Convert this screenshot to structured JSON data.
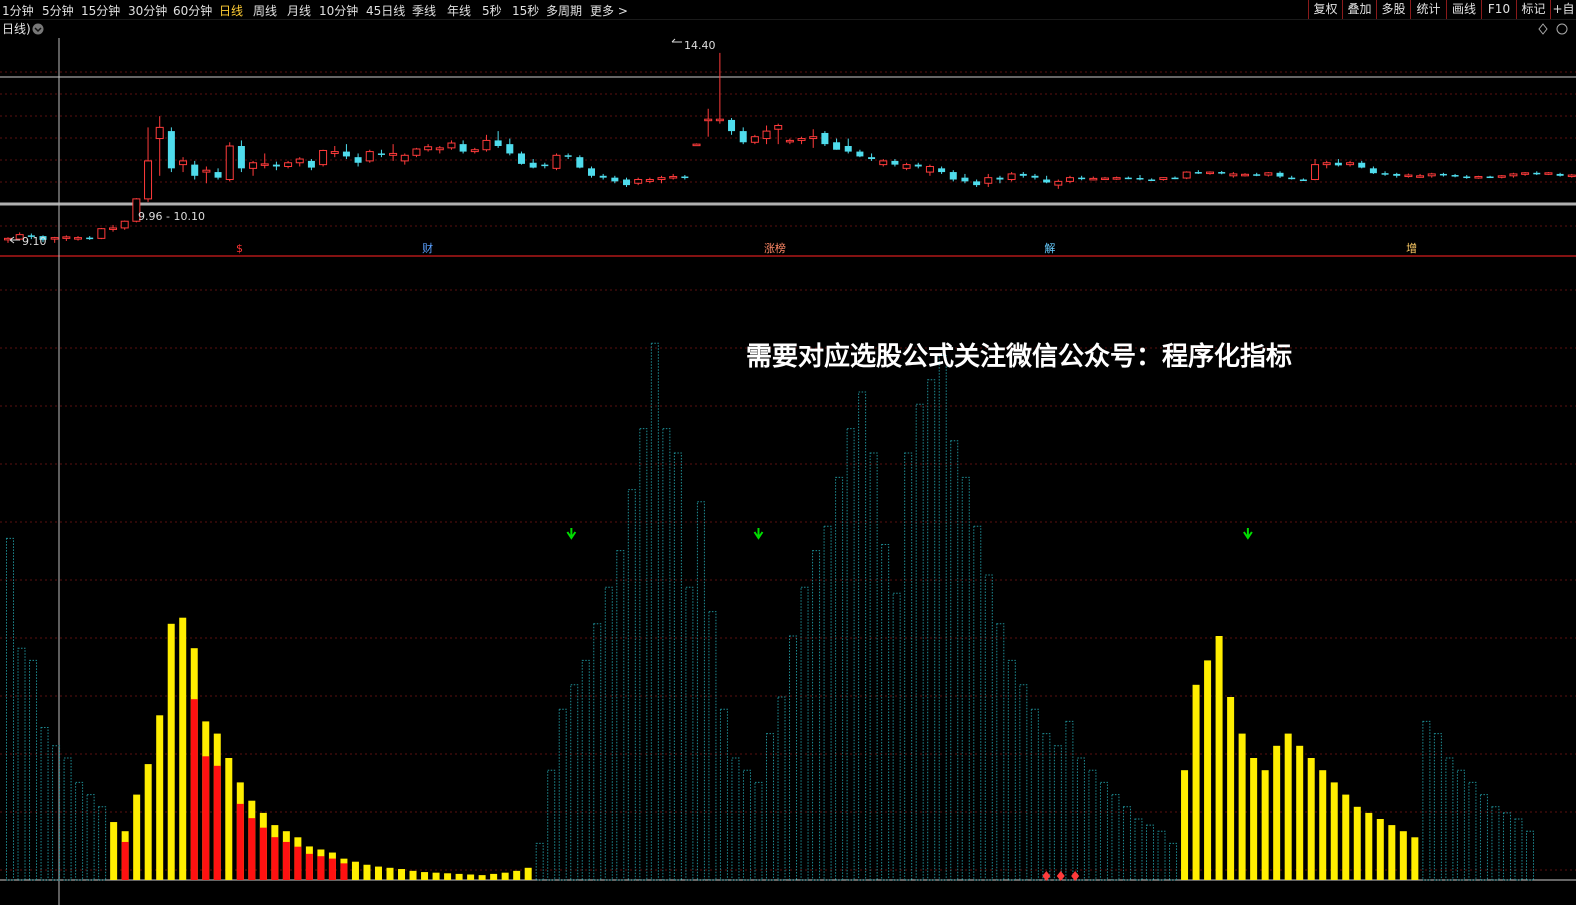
{
  "toolbar": {
    "periods": [
      "1分钟",
      "5分钟",
      "15分钟",
      "30分钟",
      "60分钟",
      "日线",
      "周线",
      "月线",
      "10分钟",
      "45日线",
      "季线",
      "年线",
      "5秒",
      "15秒",
      "多周期",
      "更多 >"
    ],
    "active_period": "日线",
    "tools": [
      "复权",
      "叠加",
      "多股",
      "统计",
      "画线",
      "F10",
      "标记",
      "+自"
    ]
  },
  "panel": {
    "label": "日线)"
  },
  "colors": {
    "up": "#ff3b3b",
    "down": "#4fdcec",
    "volume_default": "#1e8d95",
    "volume_yellow": "#ffee00",
    "volume_red": "#ff1111",
    "marker_green": "#00dd00",
    "annotation_text": "#ffffff"
  },
  "annotation": "需要对应选股公式关注微信公众号：程序化指标",
  "chart_data": [
    {
      "type": "candlestick",
      "high_label": "14.40",
      "low_label": "9.10",
      "range_label": "9.96 - 10.10",
      "ylim": [
        9.0,
        14.8
      ],
      "events": [
        {
          "index": 16,
          "label": "$"
        },
        {
          "index": 29,
          "label": "财"
        },
        {
          "index": 53,
          "label": "涨榜"
        },
        {
          "index": 72,
          "label": "解"
        },
        {
          "index": 97,
          "label": "增"
        }
      ],
      "candles": [
        [
          9.38,
          9.45,
          9.3,
          9.42
        ],
        [
          9.4,
          9.58,
          9.36,
          9.52
        ],
        [
          9.5,
          9.55,
          9.4,
          9.48
        ],
        [
          9.48,
          9.5,
          9.32,
          9.38
        ],
        [
          9.4,
          9.46,
          9.3,
          9.44
        ],
        [
          9.42,
          9.5,
          9.35,
          9.46
        ],
        [
          9.44,
          9.48,
          9.36,
          9.44
        ],
        [
          9.44,
          9.48,
          9.38,
          9.42
        ],
        [
          9.42,
          9.7,
          9.4,
          9.68
        ],
        [
          9.66,
          9.78,
          9.6,
          9.7
        ],
        [
          9.7,
          9.9,
          9.65,
          9.88
        ],
        [
          9.88,
          10.5,
          9.85,
          10.48
        ],
        [
          10.48,
          12.4,
          10.4,
          11.5
        ],
        [
          12.1,
          12.7,
          11.1,
          12.4
        ],
        [
          12.3,
          12.4,
          11.2,
          11.3
        ],
        [
          11.4,
          11.6,
          11.2,
          11.5
        ],
        [
          11.4,
          11.5,
          11.0,
          11.1
        ],
        [
          11.2,
          11.35,
          10.9,
          11.25
        ],
        [
          11.2,
          11.3,
          11.0,
          11.05
        ],
        [
          11.0,
          12.0,
          10.95,
          11.9
        ],
        [
          11.9,
          12.05,
          11.2,
          11.3
        ],
        [
          11.3,
          11.5,
          11.1,
          11.45
        ],
        [
          11.4,
          11.7,
          11.3,
          11.42
        ],
        [
          11.4,
          11.48,
          11.25,
          11.35
        ],
        [
          11.35,
          11.5,
          11.3,
          11.45
        ],
        [
          11.45,
          11.6,
          11.35,
          11.55
        ],
        [
          11.5,
          11.55,
          11.25,
          11.32
        ],
        [
          11.4,
          11.8,
          11.35,
          11.78
        ],
        [
          11.7,
          11.9,
          11.6,
          11.75
        ],
        [
          11.75,
          11.95,
          11.55,
          11.62
        ],
        [
          11.6,
          11.7,
          11.35,
          11.45
        ],
        [
          11.5,
          11.8,
          11.45,
          11.75
        ],
        [
          11.7,
          11.8,
          11.6,
          11.68
        ],
        [
          11.65,
          11.95,
          11.5,
          11.7
        ],
        [
          11.5,
          11.7,
          11.4,
          11.65
        ],
        [
          11.65,
          11.85,
          11.6,
          11.82
        ],
        [
          11.8,
          11.95,
          11.75,
          11.88
        ],
        [
          11.8,
          11.9,
          11.7,
          11.85
        ],
        [
          11.85,
          12.05,
          11.8,
          11.98
        ],
        [
          11.95,
          12.05,
          11.7,
          11.75
        ],
        [
          11.75,
          11.85,
          11.7,
          11.8
        ],
        [
          11.8,
          12.2,
          11.75,
          12.05
        ],
        [
          12.05,
          12.3,
          11.85,
          11.9
        ],
        [
          11.95,
          12.1,
          11.65,
          11.7
        ],
        [
          11.7,
          11.75,
          11.4,
          11.42
        ],
        [
          11.45,
          11.55,
          11.3,
          11.32
        ],
        [
          11.4,
          11.45,
          11.3,
          11.38
        ],
        [
          11.3,
          11.7,
          11.25,
          11.65
        ],
        [
          11.65,
          11.7,
          11.55,
          11.62
        ],
        [
          11.6,
          11.65,
          11.3,
          11.32
        ],
        [
          11.3,
          11.35,
          11.05,
          11.1
        ],
        [
          11.1,
          11.15,
          11.0,
          11.05
        ],
        [
          11.05,
          11.1,
          10.9,
          10.95
        ],
        [
          11.0,
          11.05,
          10.8,
          10.85
        ],
        [
          10.9,
          11.05,
          10.85,
          11.0
        ],
        [
          10.95,
          11.05,
          10.9,
          11.0
        ],
        [
          11.0,
          11.1,
          10.9,
          11.05
        ],
        [
          11.05,
          11.15,
          11.0,
          11.08
        ],
        [
          11.08,
          11.12,
          11.0,
          11.05
        ]
      ],
      "candles_note": "",
      "candles_2": [
        [
          11.95,
          11.97,
          11.93,
          11.95
        ],
        [
          12.6,
          12.9,
          12.15,
          12.62
        ],
        [
          12.6,
          14.4,
          12.5,
          12.62
        ],
        [
          12.6,
          12.65,
          12.2,
          12.3
        ],
        [
          12.3,
          12.4,
          11.95,
          12.0
        ],
        [
          12.0,
          12.2,
          11.95,
          12.15
        ],
        [
          12.1,
          12.45,
          11.95,
          12.3
        ],
        [
          12.35,
          12.5,
          11.95,
          12.45
        ],
        [
          12.05,
          12.1,
          11.95,
          12.05
        ],
        [
          12.05,
          12.15,
          11.95,
          12.1
        ],
        [
          12.1,
          12.35,
          11.85,
          12.15
        ],
        [
          12.25,
          12.3,
          11.9,
          11.95
        ],
        [
          12.0,
          12.1,
          11.8,
          11.8
        ],
        [
          11.9,
          12.1,
          11.7,
          11.75
        ],
        [
          11.75,
          11.8,
          11.6,
          11.62
        ],
        [
          11.6,
          11.7,
          11.5,
          11.55
        ],
        [
          11.4,
          11.55,
          11.35,
          11.5
        ],
        [
          11.5,
          11.55,
          11.35,
          11.4
        ],
        [
          11.3,
          11.45,
          11.25,
          11.4
        ],
        [
          11.4,
          11.45,
          11.3,
          11.35
        ],
        [
          11.2,
          11.4,
          11.1,
          11.35
        ],
        [
          11.3,
          11.35,
          11.15,
          11.2
        ],
        [
          11.2,
          11.25,
          10.95,
          11.0
        ],
        [
          11.05,
          11.15,
          10.9,
          10.95
        ],
        [
          10.95,
          11.0,
          10.8,
          10.85
        ],
        [
          10.9,
          11.15,
          10.8,
          11.05
        ],
        [
          11.05,
          11.1,
          10.9,
          11.0
        ],
        [
          11.0,
          11.2,
          10.95,
          11.15
        ],
        [
          11.15,
          11.2,
          11.05,
          11.1
        ],
        [
          11.1,
          11.15,
          11.0,
          11.05
        ],
        [
          11.0,
          11.1,
          10.9,
          10.92
        ],
        [
          10.85,
          11.0,
          10.75,
          10.95
        ],
        [
          10.95,
          11.1,
          10.9,
          11.05
        ],
        [
          11.05,
          11.1,
          10.98,
          11.02
        ],
        [
          11.03,
          11.08,
          10.98,
          11.03
        ],
        [
          11.02,
          11.07,
          10.99,
          11.04
        ],
        [
          11.03,
          11.08,
          10.99,
          11.05
        ],
        [
          11.05,
          11.08,
          11.01,
          11.04
        ],
        [
          11.04,
          11.12,
          10.98,
          11.0
        ],
        [
          11.0,
          11.03,
          10.96,
          10.98
        ],
        [
          11.0,
          11.06,
          10.97,
          11.05
        ],
        [
          11.05,
          11.08,
          11.01,
          11.04
        ],
        [
          11.04,
          11.22,
          11.01,
          11.2
        ],
        [
          11.2,
          11.25,
          11.15,
          11.18
        ],
        [
          11.18,
          11.22,
          11.13,
          11.2
        ],
        [
          11.2,
          11.23,
          11.14,
          11.18
        ],
        [
          11.1,
          11.2,
          11.05,
          11.15
        ],
        [
          11.12,
          11.17,
          11.08,
          11.14
        ],
        [
          11.14,
          11.18,
          11.09,
          11.12
        ],
        [
          11.12,
          11.2,
          11.08,
          11.18
        ],
        [
          11.18,
          11.22,
          11.04,
          11.08
        ],
        [
          11.05,
          11.1,
          11.0,
          11.03
        ],
        [
          11.0,
          11.03,
          10.97,
          10.99
        ],
        [
          11.0,
          11.55,
          10.98,
          11.4
        ],
        [
          11.4,
          11.5,
          11.3,
          11.45
        ],
        [
          11.45,
          11.55,
          11.35,
          11.38
        ],
        [
          11.4,
          11.5,
          11.35,
          11.45
        ],
        [
          11.45,
          11.5,
          11.3,
          11.32
        ],
        [
          11.3,
          11.35,
          11.15,
          11.17
        ],
        [
          11.17,
          11.22,
          11.1,
          11.15
        ],
        [
          11.15,
          11.18,
          11.05,
          11.1
        ],
        [
          11.1,
          11.16,
          11.05,
          11.12
        ],
        [
          11.1,
          11.15,
          11.05,
          11.1
        ],
        [
          11.1,
          11.18,
          11.05,
          11.15
        ],
        [
          11.15,
          11.18,
          11.08,
          11.12
        ],
        [
          11.12,
          11.15,
          11.06,
          11.08
        ],
        [
          11.08,
          11.12,
          11.02,
          11.05
        ],
        [
          11.05,
          11.1,
          11.02,
          11.08
        ],
        [
          11.08,
          11.1,
          11.04,
          11.06
        ],
        [
          11.06,
          11.12,
          11.03,
          11.1
        ],
        [
          11.1,
          11.18,
          11.05,
          11.15
        ],
        [
          11.15,
          11.2,
          11.1,
          11.18
        ],
        [
          11.18,
          11.22,
          11.12,
          11.16
        ],
        [
          11.16,
          11.2,
          11.12,
          11.18
        ],
        [
          11.15,
          11.18,
          11.08,
          11.1
        ],
        [
          11.1,
          11.15,
          11.05,
          11.12
        ]
      ]
    },
    {
      "type": "bar",
      "ylabel": "",
      "ylim": [
        0,
        100
      ],
      "values": [
        56,
        38,
        36,
        25,
        22,
        20,
        16,
        14,
        12,
        9.5,
        8,
        14,
        19,
        27,
        42,
        43,
        38,
        26,
        24,
        20,
        16,
        13,
        11,
        9,
        8,
        7,
        5.5,
        5,
        4.5,
        3.5,
        3,
        2.5,
        2.2,
        2,
        1.8,
        1.5,
        1.3,
        1.2,
        1.1,
        1,
        0.9,
        0.8,
        1,
        1.2,
        1.5,
        2,
        6,
        18,
        28,
        32,
        36,
        42,
        48,
        54,
        64,
        74,
        88,
        74,
        70,
        48,
        62,
        44,
        28,
        20,
        18,
        16,
        24,
        30,
        40,
        48,
        54,
        58,
        66,
        74,
        80,
        70,
        55,
        47,
        70,
        78,
        82,
        86,
        72,
        66,
        58,
        50,
        42,
        36,
        32,
        28,
        24,
        22,
        26,
        20,
        18,
        16,
        14,
        12,
        10,
        9,
        8,
        6,
        18,
        32,
        36,
        40,
        30,
        24,
        20,
        18,
        22,
        24,
        22,
        20,
        18,
        16,
        14,
        12,
        11,
        10,
        9,
        8,
        7,
        26,
        24,
        20,
        18,
        16,
        14,
        12,
        11,
        10,
        8
      ],
      "colors": [
        "d",
        "d",
        "d",
        "d",
        "d",
        "d",
        "d",
        "d",
        "d",
        "y",
        "r",
        "y",
        "y",
        "y",
        "y",
        "y",
        "r",
        "r",
        "r",
        "y",
        "r",
        "r",
        "r",
        "r",
        "r",
        "r",
        "r",
        "r",
        "r",
        "r",
        "y",
        "y",
        "y",
        "y",
        "y",
        "y",
        "y",
        "y",
        "y",
        "y",
        "y",
        "y",
        "y",
        "y",
        "y",
        "y",
        "d",
        "d",
        "d",
        "d",
        "d",
        "d",
        "d",
        "d",
        "d",
        "d",
        "d",
        "d",
        "d",
        "d",
        "d",
        "d",
        "d",
        "d",
        "d",
        "d",
        "d",
        "d",
        "d",
        "d",
        "d",
        "d",
        "d",
        "d",
        "d",
        "d",
        "d",
        "d",
        "d",
        "d",
        "d",
        "d",
        "d",
        "d",
        "d",
        "d",
        "d",
        "d",
        "d",
        "d",
        "d",
        "d",
        "d",
        "d",
        "d",
        "d",
        "d",
        "d",
        "d",
        "d",
        "d",
        "d",
        "y",
        "y",
        "y",
        "y",
        "y",
        "y",
        "y",
        "y",
        "y",
        "y",
        "y",
        "y",
        "y",
        "y",
        "y",
        "y",
        "y",
        "y",
        "y",
        "y",
        "y",
        "d",
        "d",
        "d",
        "d",
        "d",
        "d",
        "d",
        "d",
        "d",
        "d"
      ],
      "markers_down": [
        39,
        52,
        86
      ],
      "markers_diamond": [
        72,
        73,
        74
      ]
    }
  ]
}
